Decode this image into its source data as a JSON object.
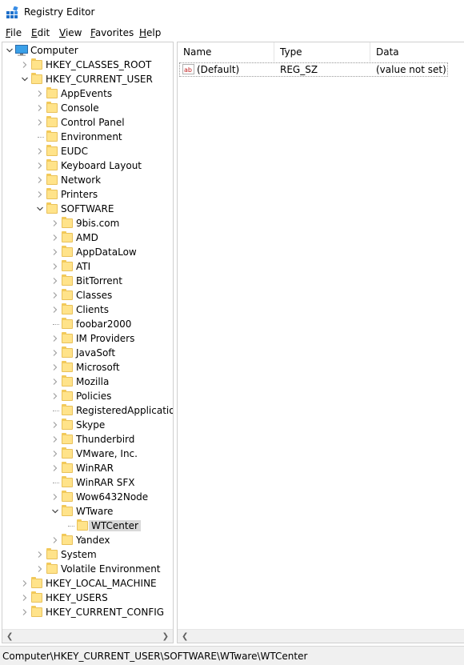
{
  "window": {
    "title": "Registry Editor"
  },
  "menu": [
    {
      "label": "File",
      "key": "F",
      "rest": "ile"
    },
    {
      "label": "Edit",
      "key": "E",
      "rest": "dit"
    },
    {
      "label": "View",
      "key": "V",
      "rest": "iew"
    },
    {
      "label": "Favorites",
      "key": "F",
      "rest": "avorites",
      "prefix": ""
    },
    {
      "label": "Help",
      "key": "H",
      "rest": "elp"
    }
  ],
  "tree": [
    {
      "label": "Computer",
      "level": 0,
      "expander": "expanded",
      "icon": "computer-icon"
    },
    {
      "label": "HKEY_CLASSES_ROOT",
      "level": 1,
      "expander": "collapsed",
      "icon": "folder-icon"
    },
    {
      "label": "HKEY_CURRENT_USER",
      "level": 1,
      "expander": "expanded",
      "icon": "folder-icon"
    },
    {
      "label": "AppEvents",
      "level": 2,
      "expander": "collapsed",
      "icon": "folder-icon"
    },
    {
      "label": "Console",
      "level": 2,
      "expander": "collapsed",
      "icon": "folder-icon"
    },
    {
      "label": "Control Panel",
      "level": 2,
      "expander": "collapsed",
      "icon": "folder-icon"
    },
    {
      "label": "Environment",
      "level": 2,
      "expander": "none",
      "icon": "folder-icon"
    },
    {
      "label": "EUDC",
      "level": 2,
      "expander": "collapsed",
      "icon": "folder-icon"
    },
    {
      "label": "Keyboard Layout",
      "level": 2,
      "expander": "collapsed",
      "icon": "folder-icon"
    },
    {
      "label": "Network",
      "level": 2,
      "expander": "collapsed",
      "icon": "folder-icon"
    },
    {
      "label": "Printers",
      "level": 2,
      "expander": "collapsed",
      "icon": "folder-icon"
    },
    {
      "label": "SOFTWARE",
      "level": 2,
      "expander": "expanded",
      "icon": "folder-icon"
    },
    {
      "label": "9bis.com",
      "level": 3,
      "expander": "collapsed",
      "icon": "folder-icon"
    },
    {
      "label": "AMD",
      "level": 3,
      "expander": "collapsed",
      "icon": "folder-icon"
    },
    {
      "label": "AppDataLow",
      "level": 3,
      "expander": "collapsed",
      "icon": "folder-icon"
    },
    {
      "label": "ATI",
      "level": 3,
      "expander": "collapsed",
      "icon": "folder-icon"
    },
    {
      "label": "BitTorrent",
      "level": 3,
      "expander": "collapsed",
      "icon": "folder-icon"
    },
    {
      "label": "Classes",
      "level": 3,
      "expander": "collapsed",
      "icon": "folder-icon"
    },
    {
      "label": "Clients",
      "level": 3,
      "expander": "collapsed",
      "icon": "folder-icon"
    },
    {
      "label": "foobar2000",
      "level": 3,
      "expander": "none",
      "icon": "folder-icon"
    },
    {
      "label": "IM Providers",
      "level": 3,
      "expander": "collapsed",
      "icon": "folder-icon"
    },
    {
      "label": "JavaSoft",
      "level": 3,
      "expander": "collapsed",
      "icon": "folder-icon"
    },
    {
      "label": "Microsoft",
      "level": 3,
      "expander": "collapsed",
      "icon": "folder-icon"
    },
    {
      "label": "Mozilla",
      "level": 3,
      "expander": "collapsed",
      "icon": "folder-icon"
    },
    {
      "label": "Policies",
      "level": 3,
      "expander": "collapsed",
      "icon": "folder-icon"
    },
    {
      "label": "RegisteredApplication",
      "level": 3,
      "expander": "none",
      "icon": "folder-icon"
    },
    {
      "label": "Skype",
      "level": 3,
      "expander": "collapsed",
      "icon": "folder-icon"
    },
    {
      "label": "Thunderbird",
      "level": 3,
      "expander": "collapsed",
      "icon": "folder-icon"
    },
    {
      "label": "VMware, Inc.",
      "level": 3,
      "expander": "collapsed",
      "icon": "folder-icon"
    },
    {
      "label": "WinRAR",
      "level": 3,
      "expander": "collapsed",
      "icon": "folder-icon"
    },
    {
      "label": "WinRAR SFX",
      "level": 3,
      "expander": "none",
      "icon": "folder-icon"
    },
    {
      "label": "Wow6432Node",
      "level": 3,
      "expander": "collapsed",
      "icon": "folder-icon"
    },
    {
      "label": "WTware",
      "level": 3,
      "expander": "expanded",
      "icon": "folder-icon"
    },
    {
      "label": "WTCenter",
      "level": 4,
      "expander": "none",
      "icon": "folder-icon",
      "selected": true
    },
    {
      "label": "Yandex",
      "level": 3,
      "expander": "collapsed",
      "icon": "folder-icon"
    },
    {
      "label": "System",
      "level": 2,
      "expander": "collapsed",
      "icon": "folder-icon"
    },
    {
      "label": "Volatile Environment",
      "level": 2,
      "expander": "collapsed",
      "icon": "folder-icon"
    },
    {
      "label": "HKEY_LOCAL_MACHINE",
      "level": 1,
      "expander": "collapsed",
      "icon": "folder-icon"
    },
    {
      "label": "HKEY_USERS",
      "level": 1,
      "expander": "collapsed",
      "icon": "folder-icon"
    },
    {
      "label": "HKEY_CURRENT_CONFIG",
      "level": 1,
      "expander": "collapsed",
      "icon": "folder-icon"
    }
  ],
  "list": {
    "columns": [
      "Name",
      "Type",
      "Data"
    ],
    "rows": [
      {
        "name": "(Default)",
        "type": "REG_SZ",
        "data": "(value not set)",
        "icon": "string-value-icon"
      }
    ]
  },
  "status": {
    "path": "Computer\\HKEY_CURRENT_USER\\SOFTWARE\\WTware\\WTCenter"
  },
  "colors": {
    "folder": "#ffe38a",
    "selection": "#d9d9d9",
    "accent": "#0078d7"
  }
}
